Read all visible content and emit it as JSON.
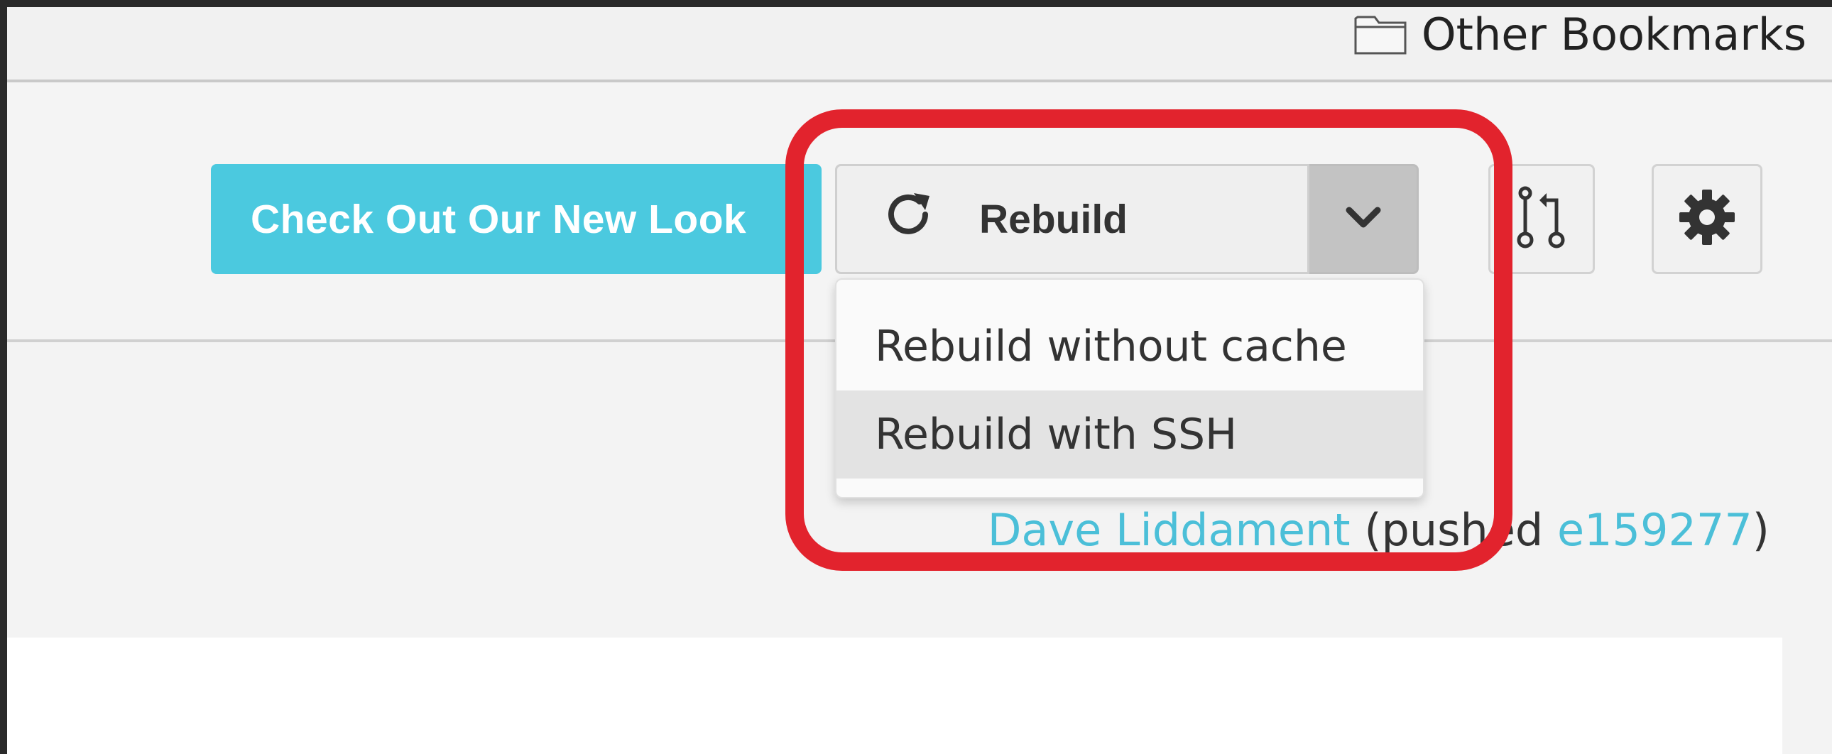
{
  "bookmarks_bar": {
    "other_bookmarks_label": "Other Bookmarks",
    "folder_icon": "folder-icon"
  },
  "header": {
    "new_look_button": "Check Out Our New Look",
    "rebuild_button": {
      "label": "Rebuild",
      "icon": "refresh-icon",
      "caret_icon": "chevron-down-icon"
    },
    "pull_request_icon": "pull-request-icon",
    "settings_icon": "gear-icon"
  },
  "dropdown": {
    "items": [
      {
        "label": "Rebuild without cache",
        "hovered": false
      },
      {
        "label": "Rebuild with SSH",
        "hovered": true
      }
    ]
  },
  "pushed_line": {
    "author": "Dave Liddament",
    "prefix": "(pushed ",
    "commit": "e159277",
    "suffix": ")"
  },
  "colors": {
    "accent": "#4bc9df",
    "link": "#4bbfd8",
    "annotation": "#e2232d"
  }
}
